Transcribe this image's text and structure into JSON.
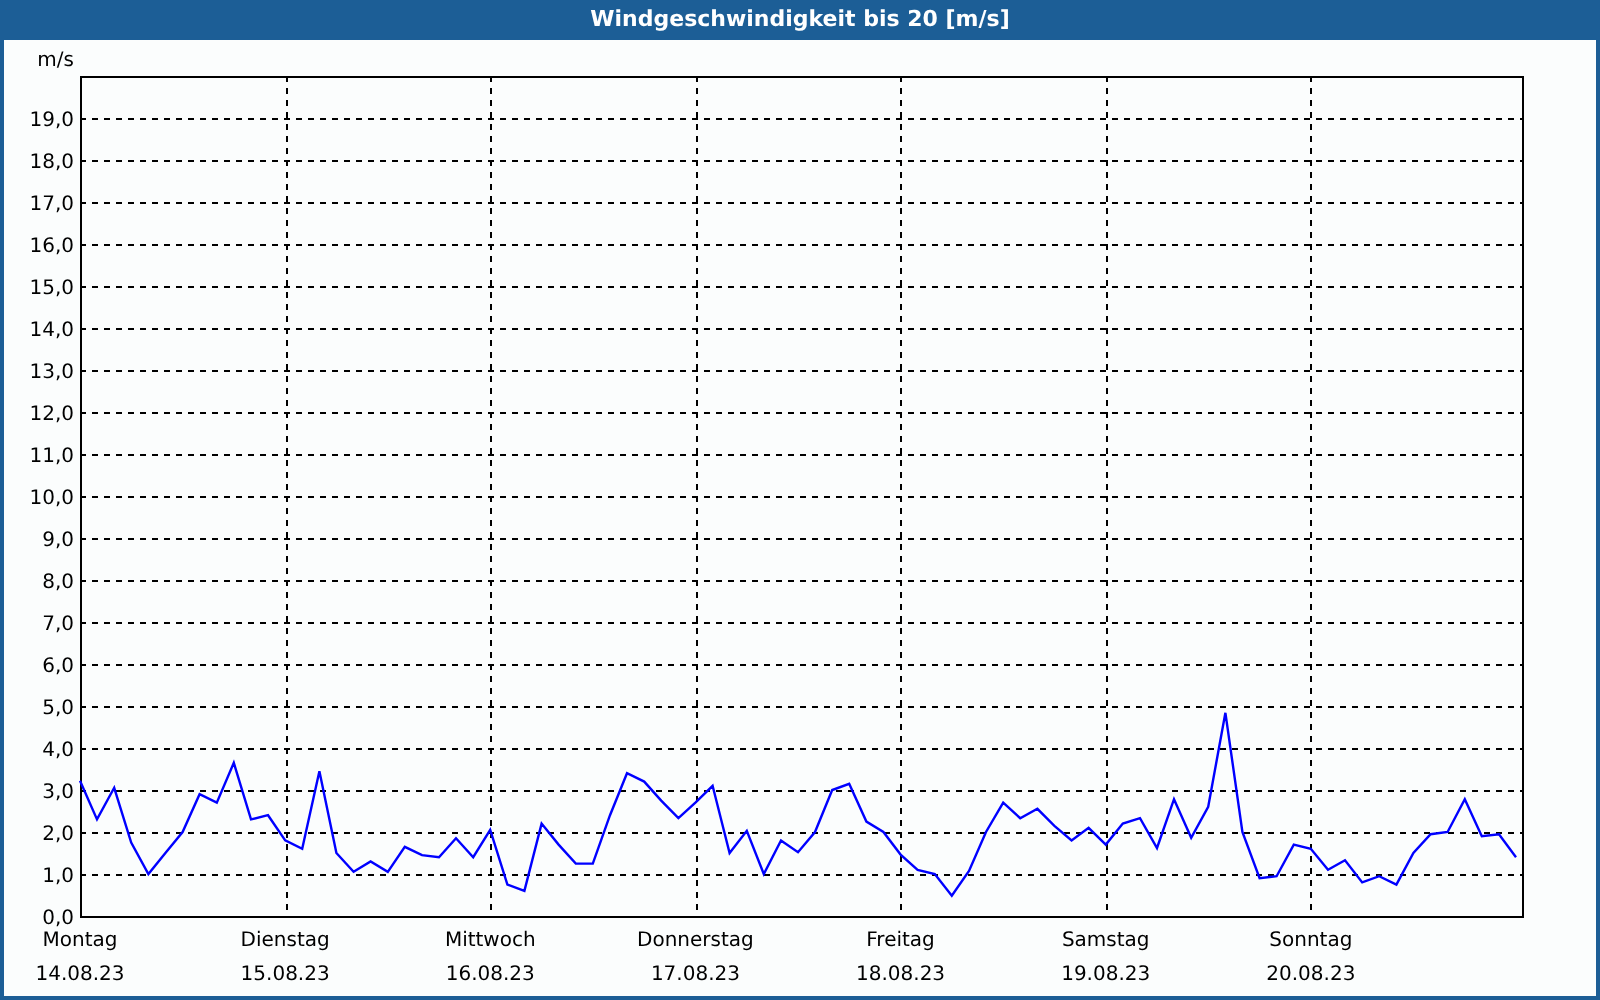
{
  "window": {
    "title": "Windgeschwindigkeit bis 20 [m/s]"
  },
  "chart_data": {
    "type": "line",
    "grid": true,
    "ylabel": "m/s",
    "ylim": [
      0,
      20
    ],
    "categories": [
      "Montag\n14.08.23",
      null,
      null,
      null,
      null,
      null,
      null,
      null,
      null,
      null,
      null,
      null,
      "Dienstag\n15.08.23",
      null,
      null,
      null,
      null,
      null,
      null,
      null,
      null,
      null,
      null,
      null,
      "Mittwoch\n16.08.23",
      null,
      null,
      null,
      null,
      null,
      null,
      null,
      null,
      null,
      null,
      null,
      "Donnerstag\n17.08.23",
      null,
      null,
      null,
      null,
      null,
      null,
      null,
      null,
      null,
      null,
      null,
      "Freitag\n18.08.23",
      null,
      null,
      null,
      null,
      null,
      null,
      null,
      null,
      null,
      null,
      null,
      "Samstag\n19.08.23",
      null,
      null,
      null,
      null,
      null,
      null,
      null,
      null,
      null,
      null,
      null,
      "Sonntag\n20.08.23",
      null,
      null,
      null,
      null,
      null,
      null,
      null,
      null,
      null,
      null,
      null,
      null
    ],
    "yticks": [
      {
        "value": 0,
        "label": "0,0"
      },
      {
        "value": 1,
        "label": "1,0"
      },
      {
        "value": 2,
        "label": "2,0"
      },
      {
        "value": 3,
        "label": "3,0"
      },
      {
        "value": 4,
        "label": "4,0"
      },
      {
        "value": 5,
        "label": "5,0"
      },
      {
        "value": 6,
        "label": "6,0"
      },
      {
        "value": 7,
        "label": "7,0"
      },
      {
        "value": 8,
        "label": "8,0"
      },
      {
        "value": 9,
        "label": "9,0"
      },
      {
        "value": 10,
        "label": "10,0"
      },
      {
        "value": 11,
        "label": "11,0"
      },
      {
        "value": 12,
        "label": "12,0"
      },
      {
        "value": 13,
        "label": "13,0"
      },
      {
        "value": 14,
        "label": "14,0"
      },
      {
        "value": 15,
        "label": "15,0"
      },
      {
        "value": 16,
        "label": "16,0"
      },
      {
        "value": 17,
        "label": "17,0"
      },
      {
        "value": 18,
        "label": "18,0"
      },
      {
        "value": 19,
        "label": "19,0"
      }
    ],
    "series": [
      {
        "color": "#0000ff",
        "values": [
          3.22,
          2.3,
          3.05,
          1.75,
          1.0,
          1.5,
          2.0,
          2.9,
          2.7,
          3.65,
          2.3,
          2.4,
          1.8,
          1.6,
          3.45,
          1.5,
          1.05,
          1.3,
          1.05,
          1.65,
          1.45,
          1.4,
          1.85,
          1.4,
          2.05,
          0.75,
          0.6,
          2.2,
          1.7,
          1.25,
          1.25,
          2.4,
          3.4,
          3.2,
          2.75,
          2.33,
          2.7,
          3.1,
          1.5,
          2.03,
          1.0,
          1.8,
          1.52,
          2.0,
          3.0,
          3.15,
          2.25,
          2.0,
          1.46,
          1.1,
          1.0,
          0.48,
          1.07,
          2.0,
          2.7,
          2.33,
          2.55,
          2.15,
          1.8,
          2.1,
          1.7,
          2.2,
          2.33,
          1.62,
          2.78,
          1.86,
          2.6,
          4.84,
          2.0,
          0.9,
          0.95,
          1.7,
          1.6,
          1.1,
          1.33,
          0.8,
          0.95,
          0.75,
          1.5,
          1.95,
          2.0,
          2.78,
          1.9,
          1.95,
          1.4
        ]
      }
    ]
  }
}
